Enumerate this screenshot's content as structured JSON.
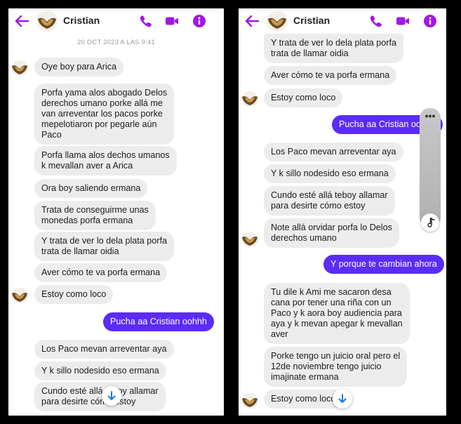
{
  "colors": {
    "accent": "#a117e8",
    "outgoing": "#5b2cf5",
    "incoming": "#ececec"
  },
  "contact": {
    "name": "Cristian"
  },
  "icons": [
    "back-arrow-icon",
    "phone-icon",
    "video-icon",
    "info-icon",
    "avatar",
    "scroll-down-icon",
    "more-icon",
    "music-note-icon"
  ],
  "left": {
    "date": "20 OCT 2023 A LAS 9:41",
    "messages": [
      {
        "dir": "in",
        "text": "Oye boy para Arica"
      },
      {
        "dir": "in",
        "text": "Porfa yama alos abogado Delos\nderechos umano porke allá me\nvan arreventar los pacos porke\nmepelotiaron por pegarle aún\nPaco"
      },
      {
        "dir": "in",
        "text": "Porfa llama alos dechos umanos\nk mevallan aver a Arica"
      },
      {
        "dir": "in",
        "text": "Ora boy saliendo ermana"
      },
      {
        "dir": "in",
        "text": "Trata de conseguirme unas\nmonedas porfa ermana"
      },
      {
        "dir": "in",
        "text": "Y trata de ver lo dela plata porfa\ntrata de llamar oidia"
      },
      {
        "dir": "in",
        "text": "Aver cómo te va porfa ermana"
      },
      {
        "dir": "in",
        "text": "Estoy como loco"
      },
      {
        "dir": "out",
        "text": "Pucha aa Cristian oohhh"
      },
      {
        "dir": "in",
        "text": "Los Paco mevan arreventar aya"
      },
      {
        "dir": "in",
        "text": "Y k sillo nodesido eso ermana"
      },
      {
        "dir": "in",
        "text": "Cundo esté allá teboy allamar\npara desirte cómo estoy"
      }
    ]
  },
  "right": {
    "messages": [
      {
        "dir": "in",
        "text": "Y trata de ver lo dela plata porfa\ntrata de llamar oidia"
      },
      {
        "dir": "in",
        "text": "Aver cómo te va porfa ermana"
      },
      {
        "dir": "in",
        "text": "Estoy como loco"
      },
      {
        "dir": "out",
        "text": "Pucha aa Cristian oohhh"
      },
      {
        "dir": "in",
        "text": "Los Paco mevan arreventar aya"
      },
      {
        "dir": "in",
        "text": "Y k sillo nodesido eso ermana"
      },
      {
        "dir": "in",
        "text": "Cundo esté allá teboy allamar\npara desirte cómo estoy"
      },
      {
        "dir": "in",
        "text": "Note allá orvidar porfa lo Delos\nderechos umano"
      },
      {
        "dir": "out",
        "text": "Y porque te cambian ahora"
      },
      {
        "dir": "in",
        "text": "Tu dile k Ami me sacaron desa\ncana por tener una riña con un\nPaco y k aora boy audiencia para\naya y k mevan apegar k mevallan\naver"
      },
      {
        "dir": "in",
        "text": "Porke tengo un juicio oral pero el\n12de noviembre tengo juicio\nimajinate ermana"
      },
      {
        "dir": "in",
        "text": "Estoy como loco"
      }
    ]
  }
}
